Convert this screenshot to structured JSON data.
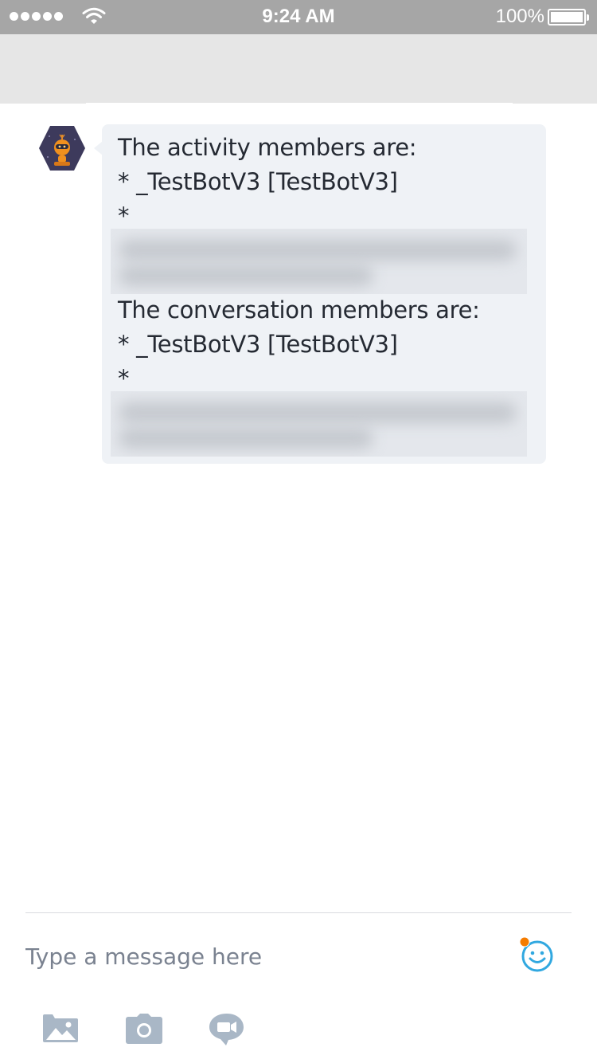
{
  "status_bar": {
    "time": "9:24 AM",
    "battery": "100%"
  },
  "chat": {
    "message_lines": [
      "The activity members are:",
      "* _TestBotV3 [TestBotV3]",
      "*",
      "The conversation members are:",
      "* _TestBotV3 [TestBotV3]",
      "*"
    ]
  },
  "composer": {
    "placeholder": "Type a message here"
  },
  "colors": {
    "status_bar_bg": "#a6a6a6",
    "header_bg": "#e6e6e6",
    "bubble_bg": "#eff2f6",
    "accent": "#31a8e0",
    "notification_dot": "#f57c00",
    "toolbar_icon": "#a9b7c6"
  },
  "icons": {
    "signal": "signal-dots-icon",
    "wifi": "wifi-icon",
    "battery": "battery-icon",
    "avatar": "bot-avatar",
    "emoji": "emoji-smiley-icon",
    "image": "image-gallery-icon",
    "camera": "camera-icon",
    "video": "video-message-icon"
  }
}
